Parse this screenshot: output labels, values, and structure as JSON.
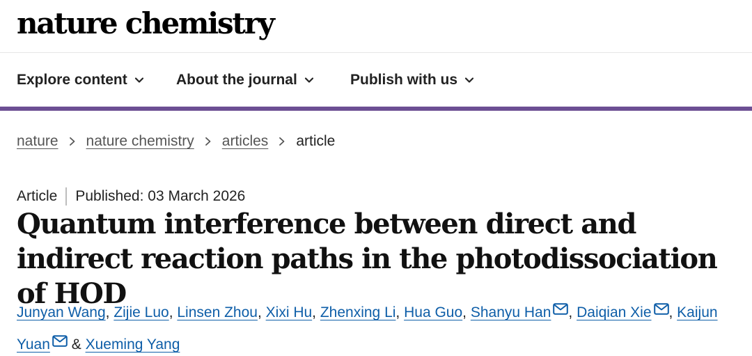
{
  "header": {
    "logo": "nature chemistry"
  },
  "nav": {
    "items": [
      {
        "label": "Explore content",
        "icon": "chevron-down-icon"
      },
      {
        "label": "About the journal",
        "icon": "chevron-down-icon"
      },
      {
        "label": "Publish with us",
        "icon": "chevron-down-icon"
      }
    ]
  },
  "breadcrumb": {
    "items": [
      "nature",
      "nature chemistry",
      "articles"
    ],
    "current": "article",
    "separator_icon": "chevron-right-icon"
  },
  "article": {
    "type": "Article",
    "published": "Published: 03 March 2026",
    "title": "Quantum interference between direct and indirect reaction paths in the photodissociation of HOD",
    "authors": [
      {
        "name": "Junyan Wang",
        "sep": ", "
      },
      {
        "name": "Zijie Luo",
        "sep": ", "
      },
      {
        "name": "Linsen Zhou",
        "sep": ", "
      },
      {
        "name": "Xixi Hu",
        "sep": ", "
      },
      {
        "name": "Zhenxing Li",
        "sep": ", "
      },
      {
        "name": "Hua Guo",
        "sep": ", "
      },
      {
        "name": "Shanyu Han",
        "sep": ", "
      },
      {
        "name": "Daiqian Xie",
        "sep": ", "
      },
      {
        "name": "Kaijun",
        "sep": " "
      },
      {
        "name": "Yuan",
        "sep": " & "
      },
      {
        "name": "Xueming Yang",
        "sep": ""
      }
    ],
    "mail_icon": "mail-icon"
  },
  "colors": {
    "accent_rule": "#6c4f93",
    "author_link": "#0e5ea8"
  }
}
